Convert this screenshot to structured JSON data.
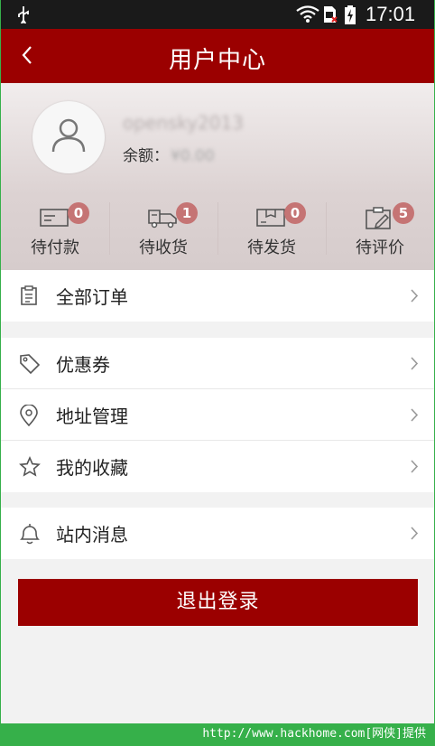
{
  "status_bar": {
    "time": "17:01",
    "icons": [
      "usb-icon",
      "wifi-icon",
      "sim-icon",
      "battery-charging-icon"
    ]
  },
  "header": {
    "title": "用户中心",
    "back_icon": "chevron-left-icon"
  },
  "profile": {
    "username": "opensky2013",
    "balance_label": "余额：",
    "balance_value": "¥0.00"
  },
  "order_stats": [
    {
      "label": "待付款",
      "count": "0",
      "icon": "payment-card-icon"
    },
    {
      "label": "待收货",
      "count": "1",
      "icon": "delivery-truck-icon"
    },
    {
      "label": "待发货",
      "count": "0",
      "icon": "package-box-icon"
    },
    {
      "label": "待评价",
      "count": "5",
      "icon": "review-clipboard-icon"
    }
  ],
  "menu": {
    "all_orders": "全部订单",
    "coupons": "优惠券",
    "address": "地址管理",
    "favorites": "我的收藏",
    "messages": "站内消息"
  },
  "logout_label": "退出登录",
  "watermark": "http://www.hackhome.com[网侠]提供",
  "colors": {
    "brand_red": "#9b0000",
    "badge": "#c57474",
    "background": "#f2f2f2"
  }
}
